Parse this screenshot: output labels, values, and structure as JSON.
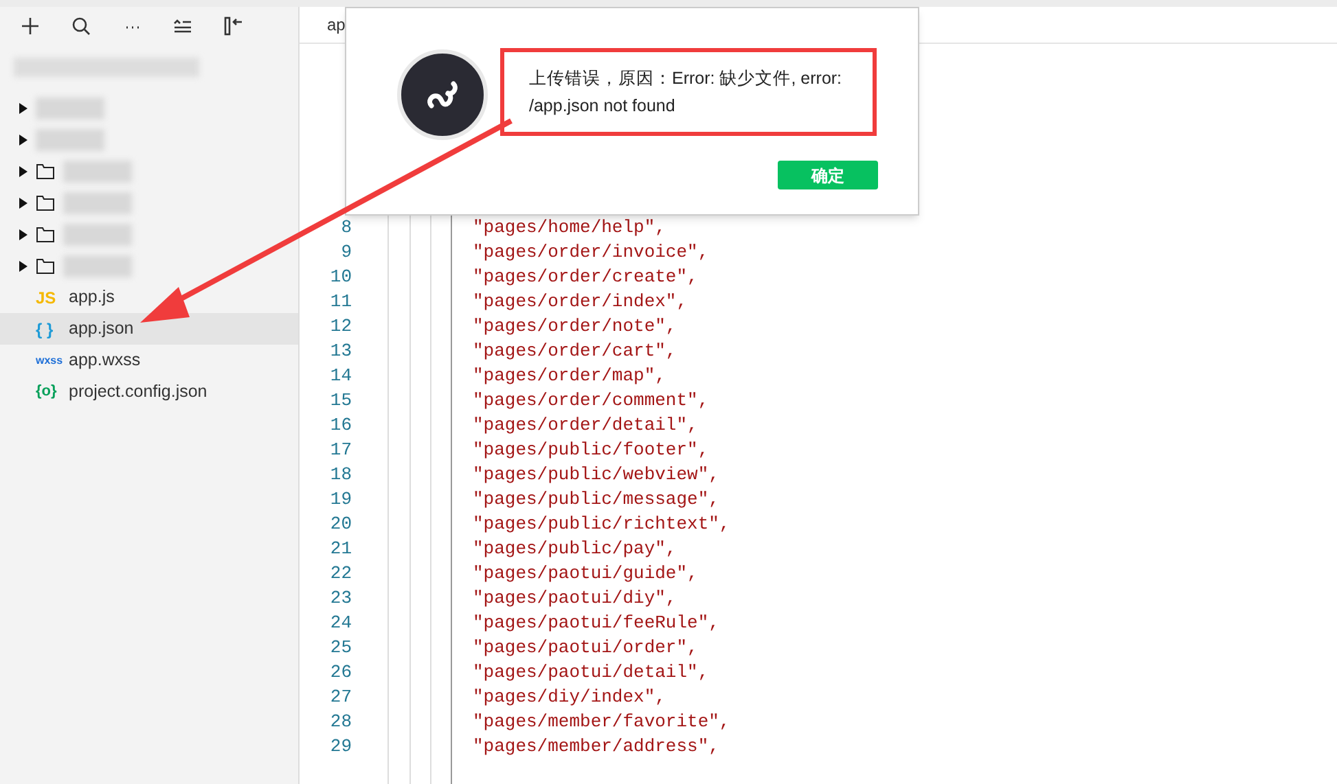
{
  "sidebar": {
    "toolbar": [
      {
        "kind": "add"
      },
      {
        "kind": "search"
      },
      {
        "kind": "more"
      },
      {
        "kind": "sort"
      },
      {
        "kind": "collapse"
      }
    ],
    "tree": [
      {
        "kind": "blurred",
        "expanded": false
      },
      {
        "kind": "blurred",
        "expanded": false
      },
      {
        "kind": "folder",
        "expanded": false
      },
      {
        "kind": "folder",
        "expanded": false
      },
      {
        "kind": "folder",
        "expanded": false
      },
      {
        "kind": "folder",
        "expanded": false
      },
      {
        "kind": "js",
        "icon": "JS",
        "name": "app.js",
        "selected": false
      },
      {
        "kind": "json",
        "icon": "{ }",
        "name": "app.json",
        "selected": true
      },
      {
        "kind": "wxss",
        "icon": "wxss",
        "name": "app.wxss",
        "selected": false
      },
      {
        "kind": "config",
        "icon": "{o}",
        "name": "project.config.json",
        "selected": false
      }
    ]
  },
  "editor": {
    "tab": "ap",
    "lines": [
      {
        "number": "8",
        "code": "\"pages/home/help\","
      },
      {
        "number": "9",
        "code": "\"pages/order/invoice\","
      },
      {
        "number": "10",
        "code": "\"pages/order/create\","
      },
      {
        "number": "11",
        "code": "\"pages/order/index\","
      },
      {
        "number": "12",
        "code": "\"pages/order/note\","
      },
      {
        "number": "13",
        "code": "\"pages/order/cart\","
      },
      {
        "number": "14",
        "code": "\"pages/order/map\","
      },
      {
        "number": "15",
        "code": "\"pages/order/comment\","
      },
      {
        "number": "16",
        "code": "\"pages/order/detail\","
      },
      {
        "number": "17",
        "code": "\"pages/public/footer\","
      },
      {
        "number": "18",
        "code": "\"pages/public/webview\","
      },
      {
        "number": "19",
        "code": "\"pages/public/message\","
      },
      {
        "number": "20",
        "code": "\"pages/public/richtext\","
      },
      {
        "number": "21",
        "code": "\"pages/public/pay\","
      },
      {
        "number": "22",
        "code": "\"pages/paotui/guide\","
      },
      {
        "number": "23",
        "code": "\"pages/paotui/diy\","
      },
      {
        "number": "24",
        "code": "\"pages/paotui/feeRule\","
      },
      {
        "number": "25",
        "code": "\"pages/paotui/order\","
      },
      {
        "number": "26",
        "code": "\"pages/paotui/detail\","
      },
      {
        "number": "27",
        "code": "\"pages/diy/index\","
      },
      {
        "number": "28",
        "code": "\"pages/member/favorite\","
      },
      {
        "number": "29",
        "code": "\"pages/member/address\","
      }
    ]
  },
  "dialog": {
    "message": "上传错误，原因：Error: 缺少文件, error: /app.json not found",
    "button": "确定"
  }
}
